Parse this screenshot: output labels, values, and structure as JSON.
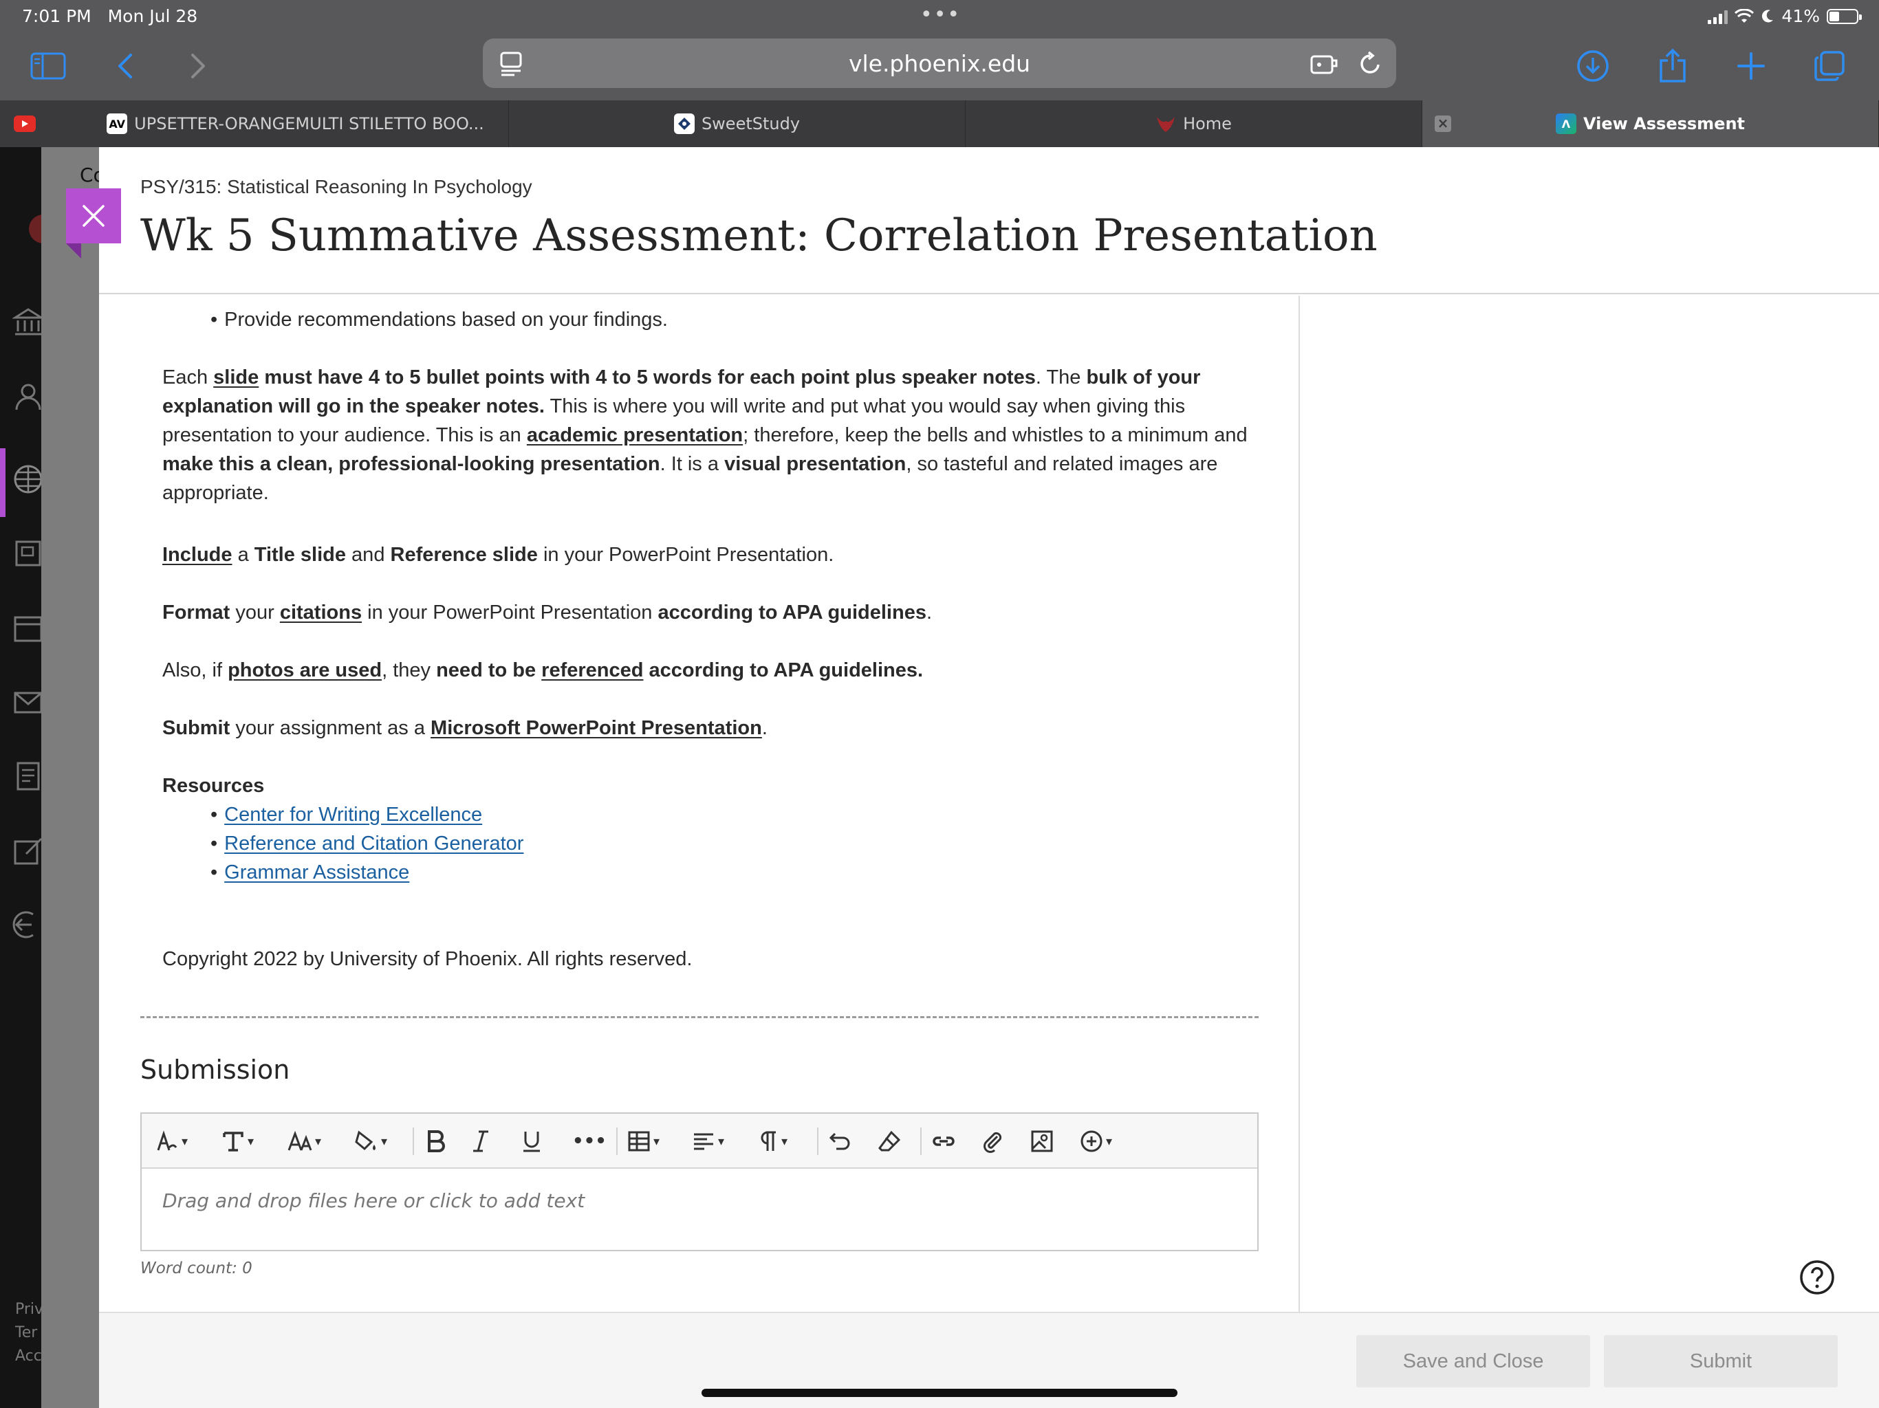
{
  "status": {
    "time": "7:01 PM",
    "date": "Mon Jul 28",
    "battery": "41%"
  },
  "browser": {
    "url": "vle.phoenix.edu",
    "tabs": [
      {
        "label": "UPSETTER-ORANGEMULTI STILETTO BOO..."
      },
      {
        "label": "SweetStudy"
      },
      {
        "label": "Home"
      },
      {
        "label": "View Assessment"
      }
    ]
  },
  "background": {
    "peek_text": "Co",
    "footer_lines": [
      "Priv",
      "Ter",
      "Acc"
    ]
  },
  "assessment": {
    "course": "PSY/315: Statistical Reasoning In Psychology",
    "title": "Wk 5 Summative Assessment: Correlation Presentation"
  },
  "content": {
    "bullet_top": "Provide recommendations based on your findings.",
    "para1": {
      "each": "Each ",
      "slide": "slide",
      "must_have": " must have 4 to 5 bullet points with 4 to 5 words for each point plus speaker notes",
      "the": ". The ",
      "bulk": "bulk of your explanation will go in the speaker notes.",
      "this_is_where": " This is where you will write and put what you would say when giving this presentation to your audience. This is an ",
      "academic": "academic presentation",
      "therefore": "; therefore, keep the bells and whistles to a minimum and ",
      "make_clean": "make this a clean, professional-looking presentation",
      "it_is_a": ". It is a ",
      "visual": "visual presentation",
      "tasteful": ", so tasteful and related images are appropriate."
    },
    "para2": {
      "include": "Include",
      "a": " a ",
      "title_slide": "Title slide",
      "and": " and ",
      "reference_slide": "Reference slide",
      "rest": " in your PowerPoint Presentation."
    },
    "para3": {
      "format": "Format",
      "your": " your ",
      "citations": "citations",
      "in": " in your PowerPoint Presentation ",
      "according": "according to APA guidelines",
      "end": "."
    },
    "para4": {
      "also": "Also, if ",
      "photos": "photos are used",
      "they": ", they ",
      "need": "need to be",
      "space": " ",
      "referenced": "referenced",
      "according": " according to APA guidelines."
    },
    "para5": {
      "submit": "Submit",
      "your": " your assignment as a ",
      "ms": "Microsoft PowerPoint Presentation",
      "end": "."
    },
    "resources_heading": "Resources",
    "resources": [
      "Center for Writing Excellence",
      "Reference and Citation Generator",
      "Grammar Assistance"
    ],
    "copyright": "Copyright 2022 by University of Phoenix. All rights reserved."
  },
  "submission": {
    "heading": "Submission",
    "placeholder": "Drag and drop files here or click to add text",
    "word_count": "Word count: 0"
  },
  "footer": {
    "save_close": "Save and Close",
    "submit": "Submit"
  },
  "colors": {
    "accent": "#b650d2",
    "link": "#1a5fa0"
  }
}
